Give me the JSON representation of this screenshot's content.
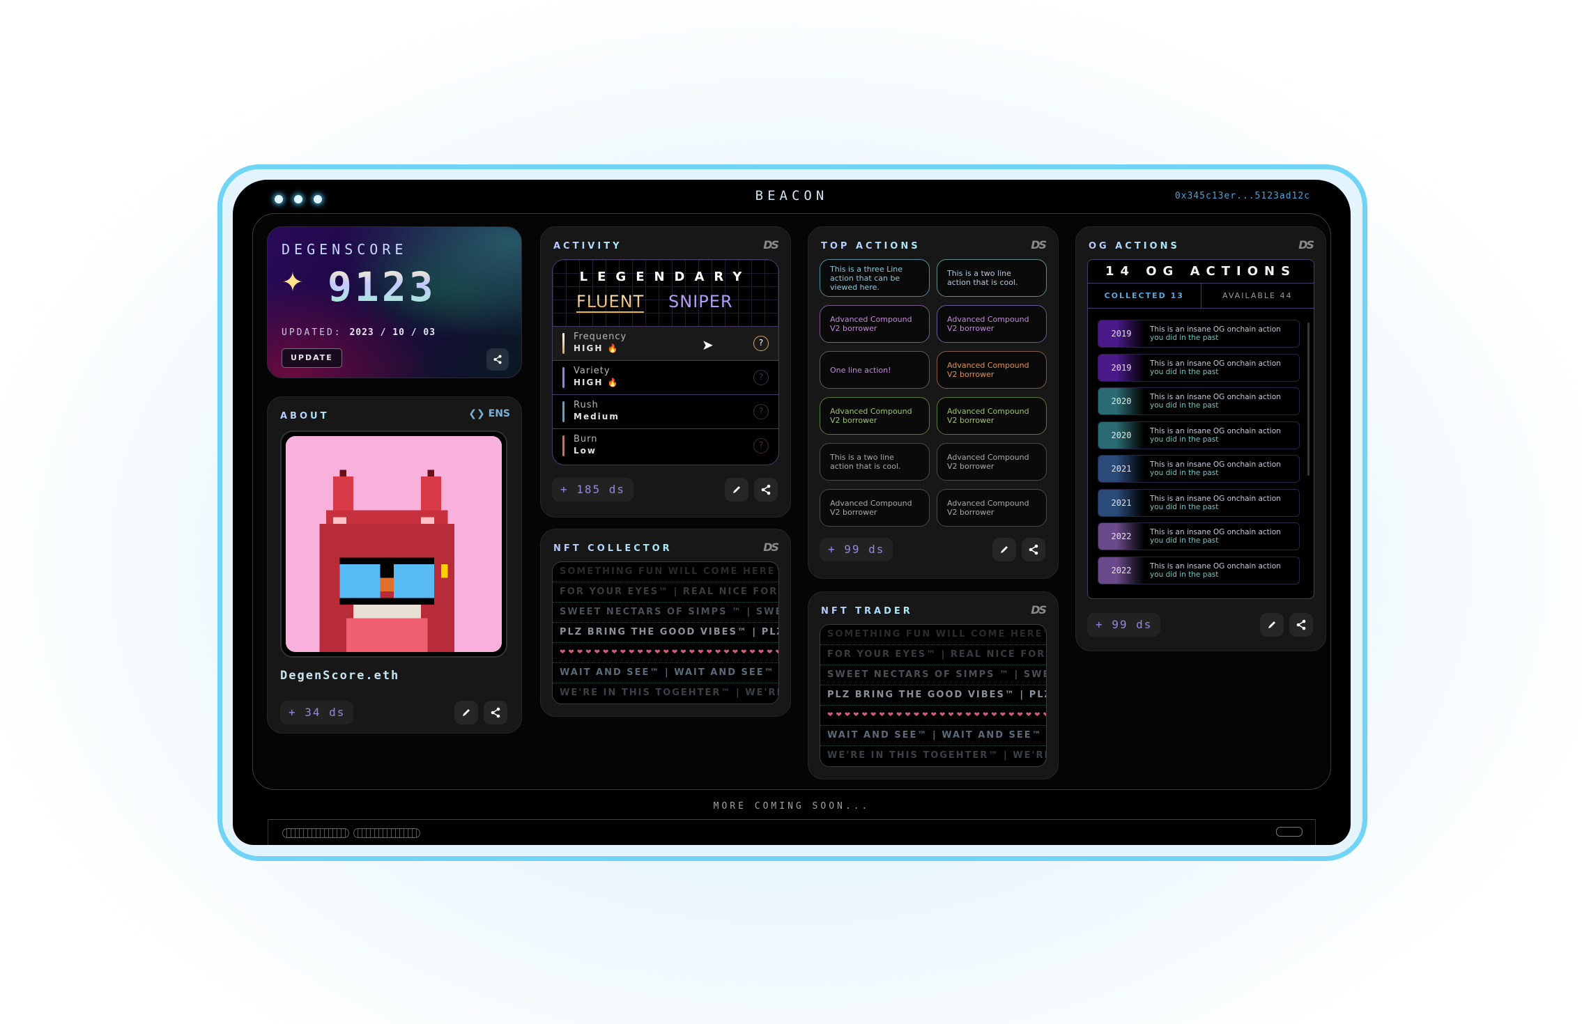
{
  "window": {
    "title": "BEACON",
    "wallet_address": "0x345c13er...5123ad12c",
    "footer": "MORE COMING SOON..."
  },
  "degenscore": {
    "label": "DEGENSCORE",
    "sparkle_icon": "sparkle-icon",
    "score": "9123",
    "updated_label": "UPDATED:",
    "updated_date": "2023 / 10 / 03",
    "update_button": "UPDATE"
  },
  "about": {
    "title": "ABOUT",
    "ens_badge": "ENS",
    "ens_name": "DegenScore.eth",
    "ds_points": "+ 34 ds"
  },
  "activity": {
    "title": "ACTIVITY",
    "logo": "DS",
    "rank": "LEGENDARY",
    "persona_first": "FLUENT",
    "persona_second": "SNIPER",
    "rows": [
      {
        "label": "Frequency",
        "value": "HIGH 🔥",
        "color": "#d9a45a"
      },
      {
        "label": "Variety",
        "value": "HIGH 🔥",
        "color": "#9b7ee0"
      },
      {
        "label": "Rush",
        "value": "Medium",
        "color": "#5aa5c4"
      },
      {
        "label": "Burn",
        "value": "Low",
        "color": "#d46a6a"
      }
    ],
    "help_glyph": "?",
    "ds_points": "+ 185 ds"
  },
  "nft_collector": {
    "title": "NFT COLLECTOR",
    "logo": "DS",
    "lines": [
      "SOMETHING FUN WILL COME HERE™",
      "FOR YOUR EYES™ | REAL NICE FOR YOUR EYES™",
      "SWEET NECTARS OF SIMPS ™ | SWEET NECTARS",
      "PLZ BRING THE GOOD VIBES™ | PLZ BRING",
      "❤❤❤❤❤❤❤❤❤❤❤❤❤❤❤❤❤❤❤❤❤❤❤❤❤❤",
      "WAIT AND SEE™  |  WAIT AND SEE™  |",
      "WE'RE IN THIS TOGEHTER™  |  WE'RE IN"
    ]
  },
  "top_actions": {
    "title": "TOP ACTIONS",
    "logo": "DS",
    "items": [
      {
        "text": "This is a three Line action that can be viewed here.",
        "color": "#8ec8d8",
        "border": "#4e8a98"
      },
      {
        "text": "This is a two line action that is cool.",
        "color": "#b8c8d8",
        "border": "#5a8a8a"
      },
      {
        "text": "Advanced Compound V2 borrower",
        "color": "#c08ad8",
        "border": "#7a5a8a"
      },
      {
        "text": "Advanced Compound V2 borrower",
        "color": "#c08ad8",
        "border": "#6a5a9a"
      },
      {
        "text": "One line action!",
        "color": "#c08ad8",
        "border": "#5a5a5a"
      },
      {
        "text": "Advanced Compound V2 borrower",
        "color": "#e0924a",
        "border": "#8a5a4a"
      },
      {
        "text": "Advanced Compound V2 borrower",
        "color": "#9ec46a",
        "border": "#5a7a3a"
      },
      {
        "text": "Advanced Compound V2 borrower",
        "color": "#9ec46a",
        "border": "#5a7a3a"
      },
      {
        "text": "This is a two line action that is cool.",
        "color": "#a8a8a8",
        "border": "#4a4a4a"
      },
      {
        "text": "Advanced Compound V2 borrower",
        "color": "#a8a8a8",
        "border": "#4a4a4a"
      },
      {
        "text": "Advanced Compound V2 borrower",
        "color": "#a8a8a8",
        "border": "#4a4a4a"
      },
      {
        "text": "Advanced Compound V2 borrower",
        "color": "#a8a8a8",
        "border": "#4a4a4a"
      }
    ],
    "ds_points": "+ 99 ds"
  },
  "nft_trader": {
    "title": "NFT TRADER",
    "logo": "DS",
    "lines": [
      "SOMETHING FUN WILL COME HERE™",
      "FOR YOUR EYES™ | REAL NICE FOR YOUR EYES™",
      "SWEET NECTARS OF SIMPS ™ | SWEET NECTARS",
      "PLZ BRING THE GOOD VIBES™ | PLZ BRING",
      "❤❤❤❤❤❤❤❤❤❤❤❤❤❤❤❤❤❤❤❤❤❤❤❤❤❤",
      "WAIT AND SEE™  |  WAIT AND SEE™  |",
      "WE'RE IN THIS TOGEHTER™  |  WE'RE IN"
    ]
  },
  "og_actions": {
    "title": "OG ACTIONS",
    "logo": "DS",
    "headline": "14 OG ACTIONS",
    "tab_collected": "COLLECTED 13",
    "tab_available": "AVAILABLE 44",
    "items": [
      {
        "year": "2019",
        "line1": "This is an insane OG onchain action",
        "line2": "you did in the past",
        "color": "#4a1a8a"
      },
      {
        "year": "2019",
        "line1": "This is an insane OG onchain action",
        "line2": "you did in the past",
        "color": "#4a1a8a"
      },
      {
        "year": "2020",
        "line1": "This is an insane OG onchain action",
        "line2": "you did in the past",
        "color": "#2a6a72"
      },
      {
        "year": "2020",
        "line1": "This is an insane OG onchain action",
        "line2": "you did in the past",
        "color": "#2a6a72"
      },
      {
        "year": "2021",
        "line1": "This is an insane OG onchain action",
        "line2": "you did in the past",
        "color": "#2a4a7a"
      },
      {
        "year": "2021",
        "line1": "This is an insane OG onchain action",
        "line2": "you did in the past",
        "color": "#2a4a7a"
      },
      {
        "year": "2022",
        "line1": "This is an insane OG onchain action",
        "line2": "you did in the past",
        "color": "#6a4a8a"
      },
      {
        "year": "2022",
        "line1": "This is an insane OG onchain action",
        "line2": "you did in the past",
        "color": "#6a4a8a"
      }
    ],
    "ds_points": "+ 99 ds"
  }
}
